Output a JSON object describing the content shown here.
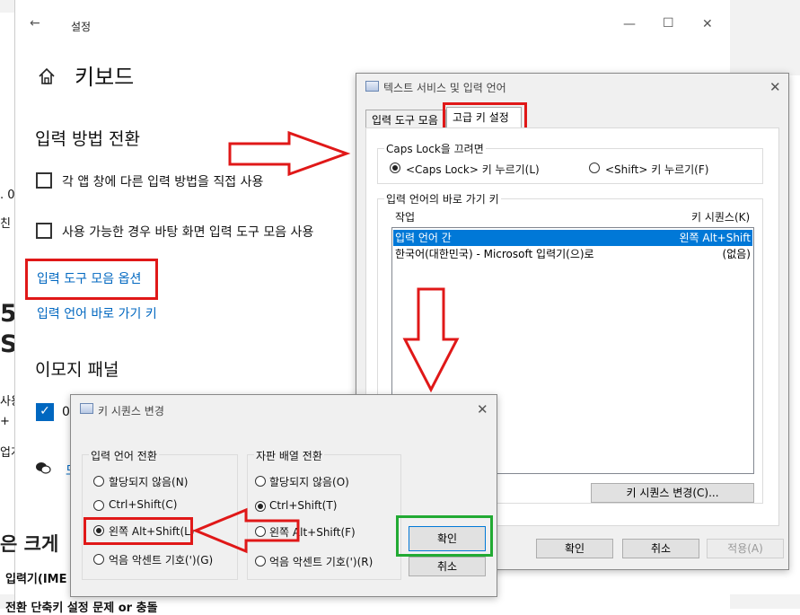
{
  "settings": {
    "back_arrow": "←",
    "window_title": "설정",
    "minimize": "—",
    "maximize": "☐",
    "close": "✕",
    "page_title": "키보드",
    "section_input_switch": "입력 방법 전환",
    "checkbox1_label": "각 앱 창에 다른 입력 방법을 직접 사용",
    "checkbox2_label": "사용 가능한 경우 바탕 화면 입력 도구 모음 사용",
    "link_toolbar_options": "입력 도구 모음 옵션",
    "link_hotkeys": "입력 언어 바로 가기 키",
    "section_emoji": "이모지 패널",
    "emoji_check_fragment": "0",
    "help_fragment": "도"
  },
  "background_fragments": {
    "frag1": ". 0",
    "frag2": "친",
    "frag3": "5",
    "frag4": "S",
    "frag5": "사용",
    "frag6": "+",
    "frag7": "업계",
    "frag8": "은 크게",
    "frag9": "입력기(IME",
    "frag10": "전환 단축키 설정 문제 or 충돌"
  },
  "text_services": {
    "title": "텍스트 서비스 및 입력 언어",
    "close": "✕",
    "tab1": "입력 도구 모음",
    "tab2": "고급 키 설정",
    "caps_group": "Caps Lock을 끄려면",
    "caps_opt1": "<Caps Lock> 키 누르기(L)",
    "caps_opt2": "<Shift> 키 누르기(F)",
    "hotkey_group": "입력 언어의 바로 가기 키",
    "col_action": "작업",
    "col_keys": "키 시퀀스(K)",
    "rows": [
      {
        "action": "입력 언어 간",
        "keys": "왼쪽 Alt+Shift"
      },
      {
        "action": "한국어(대한민국) - Microsoft 입력기(으)로",
        "keys": "(없음)"
      }
    ],
    "change_seq_button": "키 시퀀스 변경(C)...",
    "ok": "확인",
    "cancel": "취소",
    "apply": "적용(A)"
  },
  "key_sequence": {
    "title": "키 시퀀스 변경",
    "close": "✕",
    "group1": "입력 언어 전환",
    "g1_opt1": "할당되지 않음(N)",
    "g1_opt2": "Ctrl+Shift(C)",
    "g1_opt3": "왼쪽 Alt+Shift(L)",
    "g1_opt4": "억음 악센트 기호(')(G)",
    "group2": "자판 배열 전환",
    "g2_opt1": "할당되지 않음(O)",
    "g2_opt2": "Ctrl+Shift(T)",
    "g2_opt3": "왼쪽 Alt+Shift(F)",
    "g2_opt4": "억음 악센트 기호(')(R)",
    "ok": "확인",
    "cancel": "취소"
  },
  "colors": {
    "annotation_red": "#e01818",
    "annotation_green": "#22aa33",
    "link_blue": "#0067c0",
    "selection_blue": "#0078d7"
  }
}
